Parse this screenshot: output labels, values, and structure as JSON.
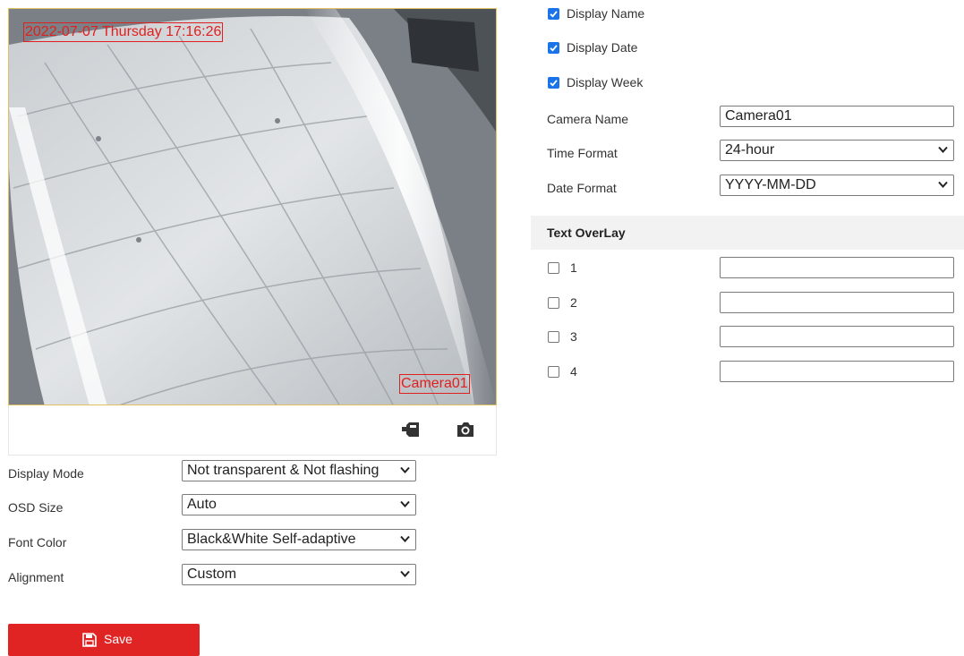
{
  "preview": {
    "osd_datetime": "2022-07-07 Thursday 17:16:26",
    "osd_camera_name": "Camera01"
  },
  "settings_left": {
    "display_mode": {
      "label": "Display Mode",
      "value": "Not transparent & Not flashing"
    },
    "osd_size": {
      "label": "OSD Size",
      "value": "Auto"
    },
    "font_color": {
      "label": "Font Color",
      "value": "Black&White Self-adaptive"
    },
    "alignment": {
      "label": "Alignment",
      "value": "Custom"
    }
  },
  "settings_right": {
    "display_name": {
      "label": "Display Name",
      "checked": true
    },
    "display_date": {
      "label": "Display Date",
      "checked": true
    },
    "display_week": {
      "label": "Display Week",
      "checked": true
    },
    "camera_name": {
      "label": "Camera Name",
      "value": "Camera01"
    },
    "time_format": {
      "label": "Time Format",
      "value": "24-hour"
    },
    "date_format": {
      "label": "Date Format",
      "value": "YYYY-MM-DD"
    }
  },
  "text_overlay": {
    "title": "Text OverLay",
    "items": [
      {
        "label": "1",
        "checked": false,
        "value": ""
      },
      {
        "label": "2",
        "checked": false,
        "value": ""
      },
      {
        "label": "3",
        "checked": false,
        "value": ""
      },
      {
        "label": "4",
        "checked": false,
        "value": ""
      }
    ]
  },
  "actions": {
    "save_label": "Save"
  },
  "colors": {
    "accent": "#1a73e8",
    "save_button": "#e02424",
    "osd_text": "#e0201e"
  },
  "icons": [
    "record-icon",
    "camera-snapshot-icon",
    "save-disk-icon",
    "chevron-down-icon",
    "checkbox-checked-icon"
  ]
}
